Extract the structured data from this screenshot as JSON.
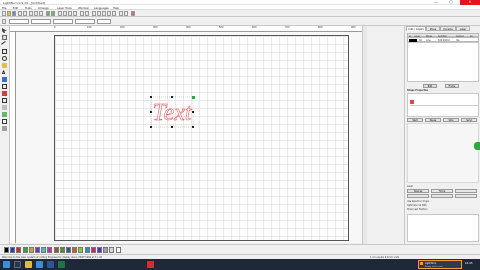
{
  "app": {
    "title": "LightBurn 0.9.24 - [Untitled]"
  },
  "window_controls": {
    "minimize": "—",
    "maximize": "□",
    "close": "✕"
  },
  "menu": [
    "File",
    "Edit",
    "Tools",
    "Arrange",
    "Laser Tools",
    "Window",
    "Languages",
    "Help"
  ],
  "ruler_top_labels": [
    "0",
    "100",
    "200",
    "300",
    "400",
    "500",
    "600",
    "700",
    "800",
    "900"
  ],
  "canvas": {
    "text": "Text"
  },
  "right_panel": {
    "tabs": [
      "Cuts / Layers",
      "Move",
      "Console",
      "Laser"
    ],
    "layer_table_headers": [
      "#",
      "Layer",
      "Mode",
      "Spd/Pwr",
      "Output",
      "Air"
    ],
    "layer_row": {
      "num": "00",
      "mode": "Line",
      "speed_power": "100.0/20.0",
      "output": "Yes"
    },
    "shape_props_title": "Shape Properties",
    "buttons": [
      "Edit",
      "Frame",
      "Start",
      "Pause",
      "Stop",
      "Send"
    ],
    "laser_section": {
      "label": "Laser",
      "devices": "Devices",
      "btn": "Home"
    },
    "checkboxes": [
      "Use Selection Origin",
      "Optimize Cut Path",
      "Show Last Position"
    ]
  },
  "palette_colors": [
    "#000000",
    "#1f3fc9",
    "#c92b2b",
    "#2fa83a",
    "#c9a12b",
    "#7b2bc9",
    "#2bc9c9",
    "#c92bb0",
    "#8a5a2b",
    "#5a8a2b",
    "#2b5a8a",
    "#c95a2b",
    "#8ac92b",
    "#2b8ac9",
    "#c92b5a",
    "#5a2bc9",
    "#a3a3a3",
    "#d8d8d8",
    "#ffffff"
  ],
  "status": {
    "left": "Welcome to the laser system of cutting Progress for display alone 2000*1000 at 3 x 40",
    "right": "1 cm equals 6.4mm units"
  },
  "taskbar": {
    "apps": [
      "start",
      "search",
      "explorer",
      "browser",
      "word",
      "excel",
      "lightburn"
    ],
    "notification": {
      "title": "Light Burn",
      "text": "Ready to be used"
    },
    "time": "10:45"
  }
}
